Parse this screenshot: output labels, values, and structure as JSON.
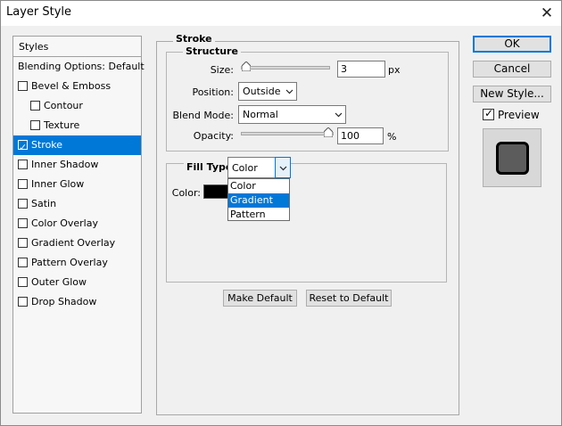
{
  "window": {
    "title": "Layer Style",
    "close_glyph": "✕"
  },
  "left_panel": {
    "header": "Styles",
    "items": [
      {
        "label": "Blending Options: Default",
        "checkbox": false,
        "checked": false,
        "selected": false,
        "indent": false
      },
      {
        "label": "Bevel & Emboss",
        "checkbox": true,
        "checked": false,
        "selected": false,
        "indent": false
      },
      {
        "label": "Contour",
        "checkbox": true,
        "checked": false,
        "selected": false,
        "indent": true
      },
      {
        "label": "Texture",
        "checkbox": true,
        "checked": false,
        "selected": false,
        "indent": true
      },
      {
        "label": "Stroke",
        "checkbox": true,
        "checked": true,
        "selected": true,
        "indent": false
      },
      {
        "label": "Inner Shadow",
        "checkbox": true,
        "checked": false,
        "selected": false,
        "indent": false
      },
      {
        "label": "Inner Glow",
        "checkbox": true,
        "checked": false,
        "selected": false,
        "indent": false
      },
      {
        "label": "Satin",
        "checkbox": true,
        "checked": false,
        "selected": false,
        "indent": false
      },
      {
        "label": "Color Overlay",
        "checkbox": true,
        "checked": false,
        "selected": false,
        "indent": false
      },
      {
        "label": "Gradient Overlay",
        "checkbox": true,
        "checked": false,
        "selected": false,
        "indent": false
      },
      {
        "label": "Pattern Overlay",
        "checkbox": true,
        "checked": false,
        "selected": false,
        "indent": false
      },
      {
        "label": "Outer Glow",
        "checkbox": true,
        "checked": false,
        "selected": false,
        "indent": false
      },
      {
        "label": "Drop Shadow",
        "checkbox": true,
        "checked": false,
        "selected": false,
        "indent": false
      }
    ]
  },
  "stroke": {
    "title": "Stroke",
    "structure": {
      "title": "Structure",
      "size_label": "Size:",
      "size_value": "3",
      "size_unit": "px",
      "size_fraction": 0.0,
      "position_label": "Position:",
      "position_value": "Outside",
      "blend_label": "Blend Mode:",
      "blend_value": "Normal",
      "opacity_label": "Opacity:",
      "opacity_value": "100",
      "opacity_unit": "%",
      "opacity_fraction": 1.0
    },
    "fill": {
      "type_label": "Fill Type:",
      "type_value": "Color",
      "options": [
        "Color",
        "Gradient",
        "Pattern"
      ],
      "highlighted": "Gradient",
      "color_label": "Color:",
      "color_value": "#000000"
    },
    "make_default": "Make Default",
    "reset_default": "Reset to Default"
  },
  "right_panel": {
    "ok": "OK",
    "cancel": "Cancel",
    "new_style": "New Style...",
    "preview_label": "Preview",
    "preview_checked": true
  },
  "colors": {
    "accent": "#0078d7",
    "background": "#f0f0f0"
  }
}
